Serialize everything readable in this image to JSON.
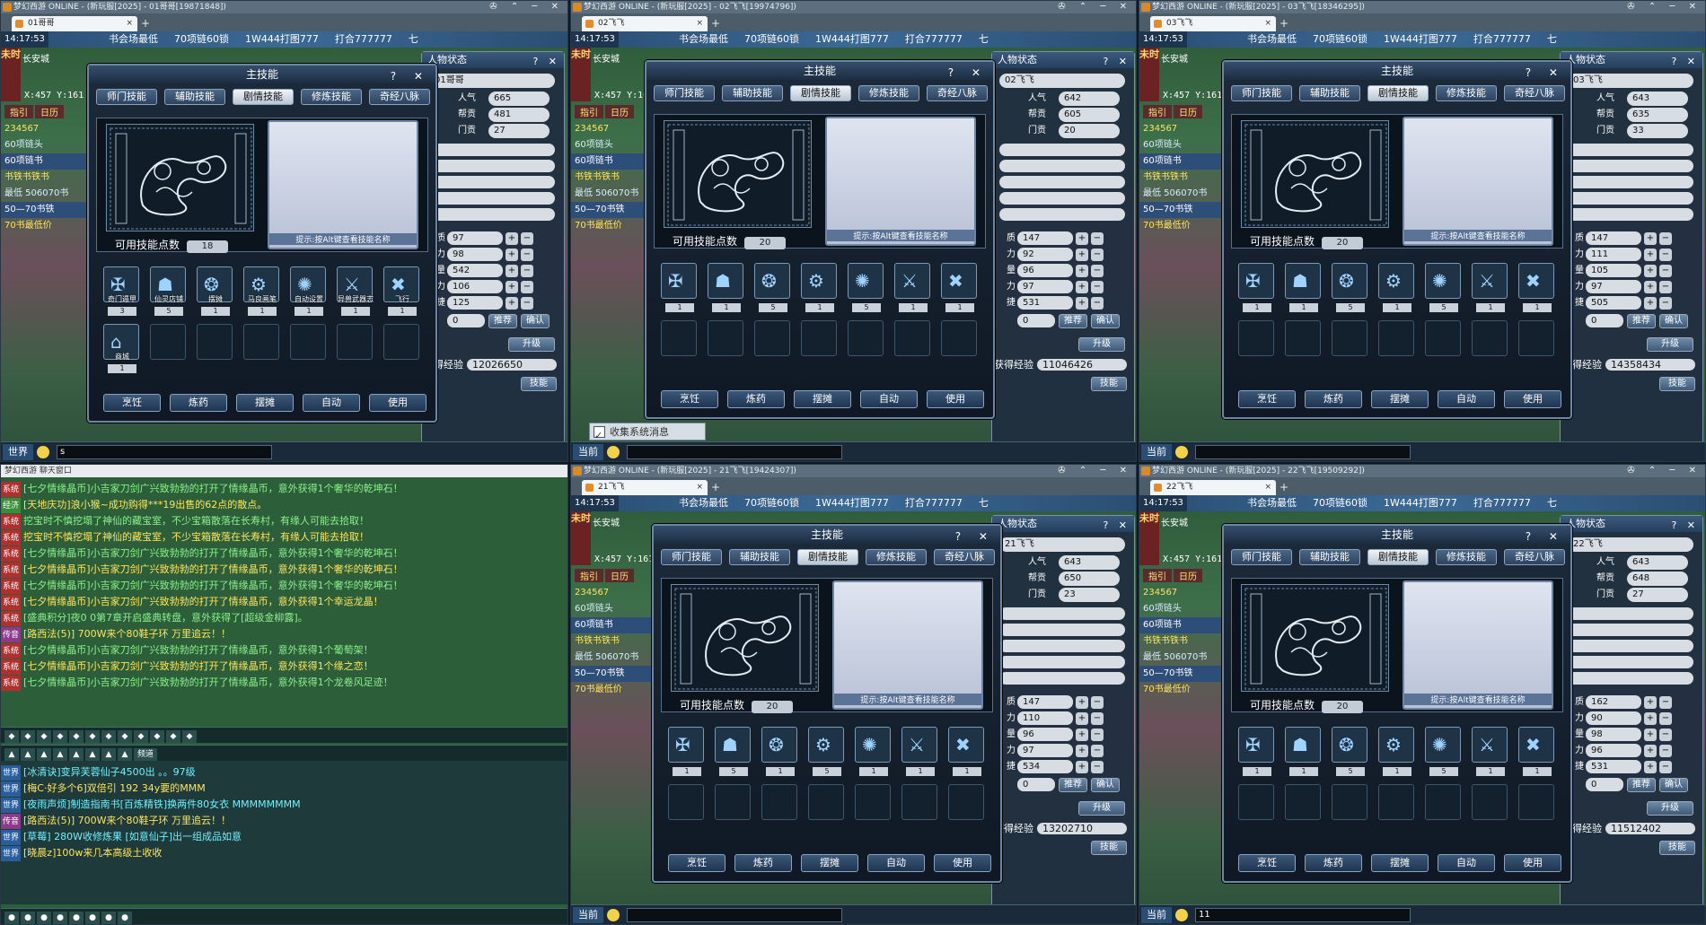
{
  "window_titles": [
    "梦幻西游 ONLINE - (新玩服[2025] - 01哥哥[19871848])",
    "梦幻西游 ONLINE - (新玩服[2025] - 02飞飞[19974796])",
    "梦幻西游 ONLINE - (新玩服[2025] - 03飞飞[18346295])",
    "梦幻西游 ONLINE - (新玩服[2025] - 21飞飞[19424307])",
    "梦幻西游 ONLINE - (新玩服[2025] - 22飞飞[19509292])"
  ],
  "tab_names": [
    "01哥哥",
    "02飞飞",
    "03飞飞",
    "21飞飞",
    "22飞飞"
  ],
  "clock": "14:17:53",
  "ticker": [
    "书会场最低",
    "70项链60锁",
    "1W444打图777",
    "打合777777",
    "七"
  ],
  "sidebar_time": "未时",
  "city": "长安城",
  "coord": "X:457 Y:161",
  "nav_links": [
    "指引",
    "日历"
  ],
  "task_rail": [
    "234567",
    "60项链头",
    "60项链书",
    "书铁书铁书",
    "最低 506070书",
    "50—70书铁",
    "70书最低价"
  ],
  "status_title": "人物状态",
  "status_ctrls": "? ✕",
  "skill": {
    "title": "主技能",
    "ctrls": "? ✕",
    "tabs": [
      "师门技能",
      "辅助技能",
      "剧情技能",
      "修炼技能",
      "奇经八脉"
    ],
    "active_tab": 2,
    "points_label": "可用技能点数",
    "hint": "提示:按Alt键查看技能名称",
    "buttons": [
      "烹饪",
      "炼药",
      "摆摊",
      "自动",
      "使用"
    ]
  },
  "status_labels": {
    "popularity": "人气",
    "contribution": "帮贡",
    "sect": "门贡",
    "recommend": "推荐",
    "confirm": "确认",
    "upgrade": "升级",
    "skills": "技能",
    "exp": "获得经验"
  },
  "attr_labels": [
    "质",
    "力",
    "量",
    "力",
    "捷"
  ],
  "accounts": [
    {
      "name": "01哥哥",
      "popularity": "665",
      "contribution": "481",
      "sect": "27",
      "attrs": [
        "97",
        "98",
        "542",
        "106",
        "125"
      ],
      "free": "0",
      "exp": "12026650",
      "points": "18",
      "skills": [
        {
          "name": "奇门遁甲",
          "lv": "3"
        },
        {
          "name": "仙灵店铺",
          "lv": "5"
        },
        {
          "name": "摆摊",
          "lv": "1"
        },
        {
          "name": "马良画笔",
          "lv": "1"
        },
        {
          "name": "自动设置",
          "lv": "1"
        },
        {
          "name": "异兽武器志",
          "lv": "1"
        },
        {
          "name": "飞行",
          "lv": "1"
        },
        {
          "name": "商城",
          "lv": "1"
        }
      ]
    },
    {
      "name": "02飞飞",
      "popularity": "642",
      "contribution": "605",
      "sect": "20",
      "attrs": [
        "147",
        "92",
        "96",
        "97",
        "531"
      ],
      "free": "0",
      "exp": "11046426",
      "points": "20",
      "skills": [
        {
          "name": "",
          "lv": "1"
        },
        {
          "name": "",
          "lv": "1"
        },
        {
          "name": "",
          "lv": "5"
        },
        {
          "name": "",
          "lv": "1"
        },
        {
          "name": "",
          "lv": "5"
        },
        {
          "name": "",
          "lv": "1"
        },
        {
          "name": "",
          "lv": "1"
        }
      ]
    },
    {
      "name": "03飞飞",
      "popularity": "643",
      "contribution": "635",
      "sect": "33",
      "attrs": [
        "147",
        "111",
        "105",
        "97",
        "505"
      ],
      "free": "0",
      "exp": "14358434",
      "points": "20",
      "skills": [
        {
          "name": "",
          "lv": "1"
        },
        {
          "name": "",
          "lv": "1"
        },
        {
          "name": "",
          "lv": "5"
        },
        {
          "name": "",
          "lv": "1"
        },
        {
          "name": "",
          "lv": "5"
        },
        {
          "name": "",
          "lv": "1"
        },
        {
          "name": "",
          "lv": "1"
        }
      ]
    },
    {
      "name": "21飞飞",
      "popularity": "643",
      "contribution": "650",
      "sect": "23",
      "attrs": [
        "147",
        "110",
        "96",
        "97",
        "534"
      ],
      "free": "0",
      "exp": "13202710",
      "points": "20",
      "skills": [
        {
          "name": "",
          "lv": "1"
        },
        {
          "name": "",
          "lv": "5"
        },
        {
          "name": "",
          "lv": "1"
        },
        {
          "name": "",
          "lv": "5"
        },
        {
          "name": "",
          "lv": "1"
        },
        {
          "name": "",
          "lv": "1"
        },
        {
          "name": "",
          "lv": "1"
        }
      ]
    },
    {
      "name": "22飞飞",
      "popularity": "643",
      "contribution": "648",
      "sect": "27",
      "attrs": [
        "162",
        "90",
        "98",
        "96",
        "531"
      ],
      "free": "0",
      "exp": "11512402",
      "points": "20",
      "skills": [
        {
          "name": "",
          "lv": "1"
        },
        {
          "name": "",
          "lv": "1"
        },
        {
          "name": "",
          "lv": "5"
        },
        {
          "name": "",
          "lv": "1"
        },
        {
          "name": "",
          "lv": "5"
        },
        {
          "name": "",
          "lv": "1"
        },
        {
          "name": "",
          "lv": "1"
        }
      ]
    }
  ],
  "bottombar_labels": [
    "世界",
    "当前",
    "当前",
    "当前",
    "当前"
  ],
  "bottom_inputs": [
    "s",
    "",
    "",
    "",
    "11"
  ],
  "chat": {
    "title": "梦幻西游 聊天窗口",
    "lines_top": [
      {
        "ch": "系统",
        "text": "[七夕情缘晶币]小吉家刀剑广兴致勃勃的打开了情缘晶币，意外获得1个奢华的乾坤石！"
      },
      {
        "ch": "经济",
        "text": "[天地庆功]浪小猴~成功购得***19出售的62点的散点。"
      },
      {
        "ch": "系统",
        "text": "挖宝时不慎挖塌了神仙的藏宝室，不少宝箱散落在长寿村，有缘人可能去拾取！"
      },
      {
        "ch": "系统",
        "text": "挖宝时不慎挖塌了神仙的藏宝室，不少宝箱散落在长寿村，有缘人可能去拾取！"
      },
      {
        "ch": "系统",
        "text": "[七夕情缘晶币]小吉家刀剑广兴致勃勃的打开了情缘晶币，意外获得1个奢华的乾坤石！"
      },
      {
        "ch": "系统",
        "text": "[七夕情缘晶币]小吉家刀剑广兴致勃勃的打开了情缘晶币，意外获得1个奢华的乾坤石！"
      },
      {
        "ch": "系统",
        "text": "[七夕情缘晶币]小吉家刀剑广兴致勃勃的打开了情缘晶币，意外获得1个奢华的乾坤石！"
      },
      {
        "ch": "系统",
        "text": "[七夕情缘晶币]小吉家刀剑广兴致勃勃的打开了情缘晶币，意外获得1个幸运龙晶！"
      },
      {
        "ch": "系统",
        "text": "[盛典积分]夜0 0第7章开启盛典转盘，意外获得了[超级金柳露]。"
      },
      {
        "ch": "传音",
        "text": "[路西法(5)] 700W来个80鞋子环 万里追云！！"
      },
      {
        "ch": "系统",
        "text": "[七夕情缘晶币]小吉家刀剑广兴致勃勃的打开了情缘晶币，意外获得1个葡萄架！"
      },
      {
        "ch": "系统",
        "text": "[七夕情缘晶币]小吉家刀剑广兴致勃勃的打开了情缘晶币，意外获得1个缘之恋！"
      },
      {
        "ch": "系统",
        "text": "[七夕情缘晶币]小吉家刀剑广兴致勃勃的打开了情缘晶币，意外获得1个龙卷风足迹！"
      }
    ],
    "lines_bottom": [
      {
        "ch": "世界",
        "text": "[冰清诀]变异芙蓉仙子4500出 。。97级"
      },
      {
        "ch": "世界",
        "text": "[梅C·好多个6]双倍引 192 34y要的MMM"
      },
      {
        "ch": "世界",
        "text": "[夜雨声烦]制造指南书[百炼精铁]换两件80女衣 MMMMMMMM"
      },
      {
        "ch": "传音",
        "text": "[路西法(5)] 700W来个80鞋子环 万里追云！！"
      },
      {
        "ch": "世界",
        "text": "[草莓] 280W收修炼果 [如意仙子]出一组成品如意"
      },
      {
        "ch": "世界",
        "text": "[晓晨z]100w来几本高级土收收"
      }
    ],
    "extra_bar_label": "频道",
    "message_label": "收集系统消息"
  }
}
